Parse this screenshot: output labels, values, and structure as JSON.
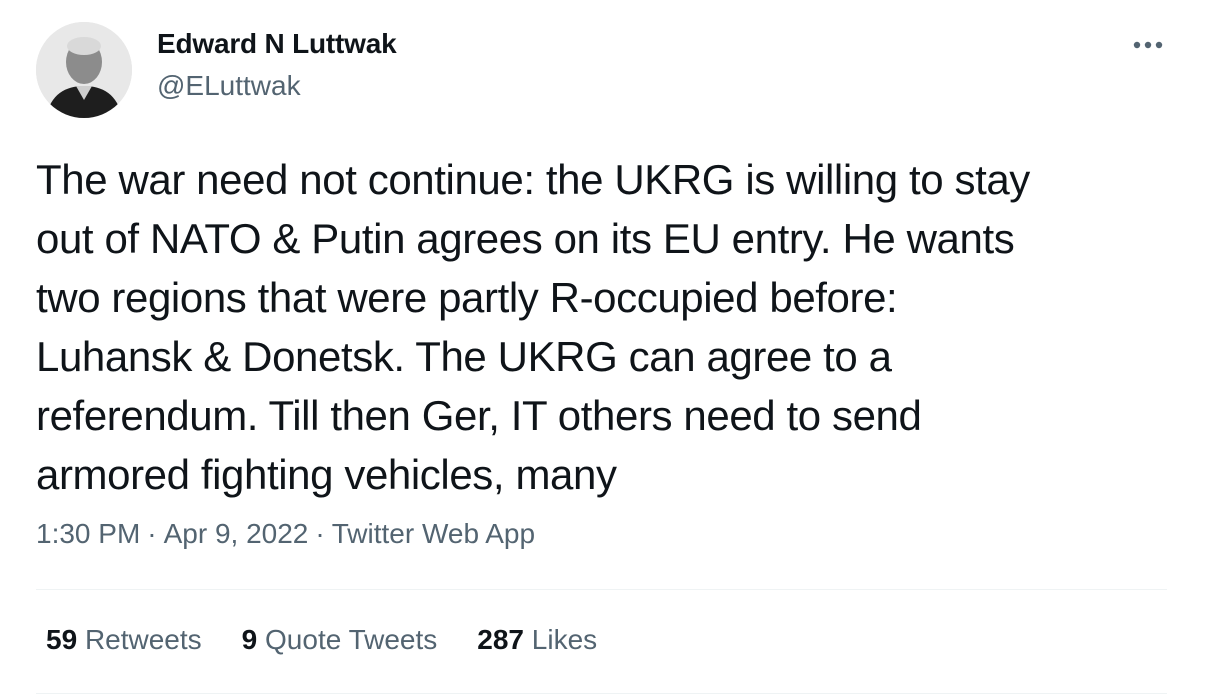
{
  "author": {
    "name": "Edward N Luttwak",
    "handle": "@ELuttwak"
  },
  "tweet": {
    "lines": [
      "The war need not continue: the UKRG is willing to stay",
      "out of NATO & Putin agrees on its EU entry. He wants",
      "two regions that were partly R-occupied before:",
      "Luhansk & Donetsk. The UKRG can agree to a",
      "referendum. Till then Ger, IT others need to send",
      "armored fighting vehicles, many"
    ],
    "time": "1:30 PM",
    "date": "Apr 9, 2022",
    "source": "Twitter Web App",
    "separator": "·"
  },
  "stats": {
    "retweets": {
      "count": "59",
      "label": "Retweets"
    },
    "quote_tweets": {
      "count": "9",
      "label": "Quote Tweets"
    },
    "likes": {
      "count": "287",
      "label": "Likes"
    }
  },
  "icons": {
    "more": "more-horizontal-icon"
  },
  "colors": {
    "primary_text": "#0f1419",
    "secondary_text": "#536471",
    "divider": "#eff3f4"
  }
}
